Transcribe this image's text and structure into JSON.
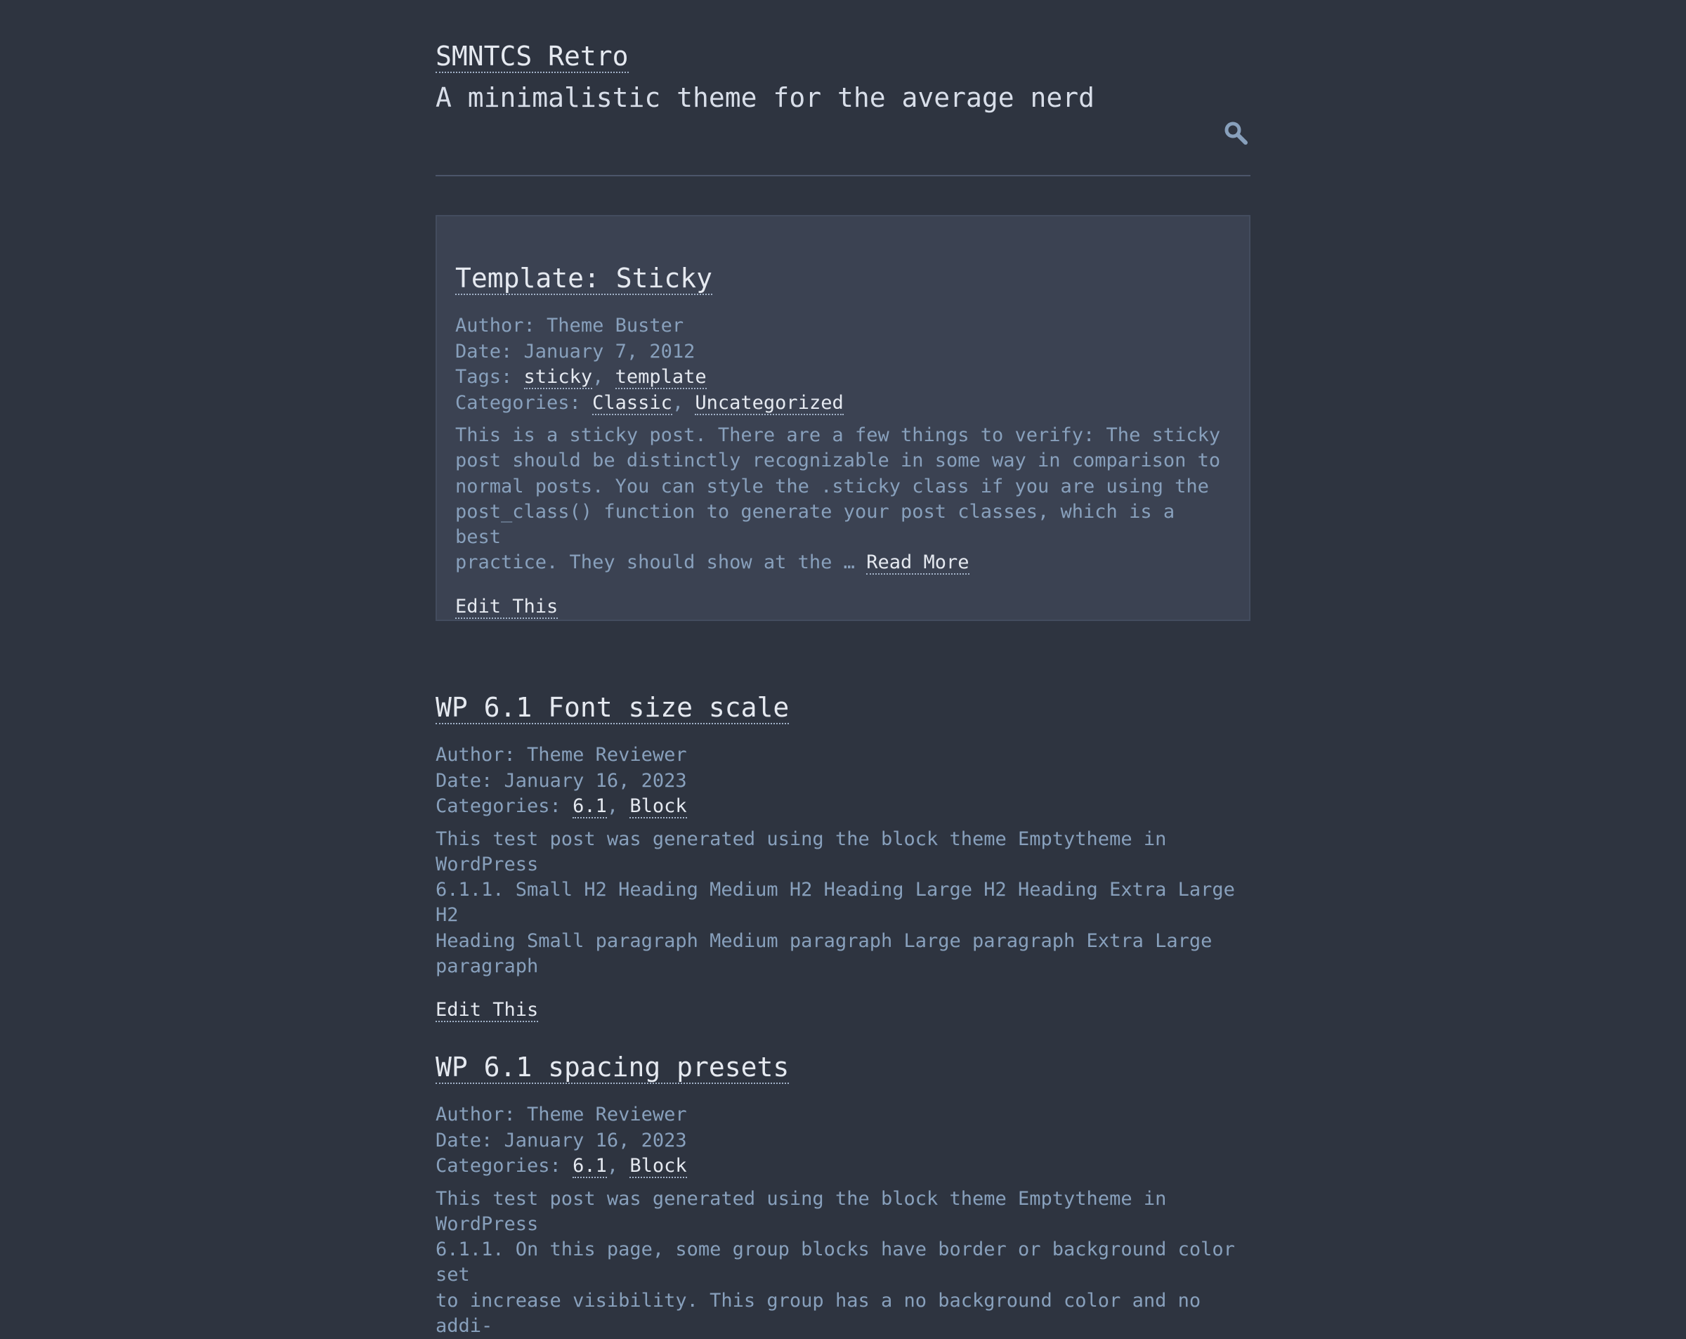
{
  "site": {
    "title": "SMNTCS Retro",
    "tagline": "A minimalistic theme for the average nerd"
  },
  "posts": [
    {
      "title": "Template: Sticky",
      "author_label": "Author: ",
      "author": "Theme Buster",
      "date_label": "Date: ",
      "date": "January 7, 2012",
      "tags_label": "Tags: ",
      "tags": [
        "sticky",
        "template"
      ],
      "categories_label": "Categories: ",
      "categories": [
        "Classic",
        "Uncategorized"
      ],
      "excerpt_lines": [
        "This is a sticky post. There are a few things to verify: The sticky",
        "post should be distinctly recognizable in some way in comparison to",
        "normal posts. You can style the .sticky class if you are using the",
        "post_class() function to generate your post classes, which is a best",
        "practice. They should show at the … "
      ],
      "read_more": "Read More",
      "edit": "Edit This"
    },
    {
      "title": "WP 6.1 Font size scale",
      "author_label": "Author: ",
      "author": "Theme Reviewer",
      "date_label": "Date: ",
      "date": "January 16, 2023",
      "categories_label": "Categories: ",
      "categories": [
        "6.1",
        "Block"
      ],
      "excerpt_lines": [
        "This test post was generated using the block theme Emptytheme in WordPress",
        "6.1.1. Small H2 Heading Medium H2 Heading Large H2 Heading Extra Large H2",
        "Heading Small paragraph Medium paragraph Large paragraph Extra Large",
        "paragraph"
      ],
      "edit": "Edit This"
    },
    {
      "title": "WP 6.1 spacing presets",
      "author_label": "Author: ",
      "author": "Theme Reviewer",
      "date_label": "Date: ",
      "date": "January 16, 2023",
      "categories_label": "Categories: ",
      "categories": [
        "6.1",
        "Block"
      ],
      "excerpt_lines": [
        "This test post was generated using the block theme Emptytheme in WordPress",
        "6.1.1. On this page, some group blocks have border or background color set",
        "to increase visibility. This group has a no background color and no addi-"
      ]
    }
  ],
  "icons": {
    "search": "magnifier-icon",
    "accent": "#88a0bc"
  }
}
